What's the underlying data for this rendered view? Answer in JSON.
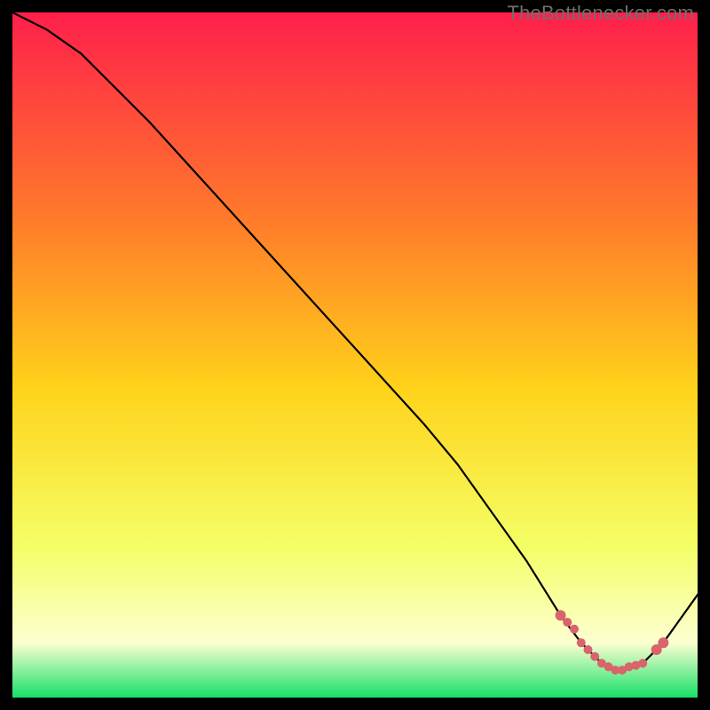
{
  "watermark": "TheBottlenecker.com",
  "colors": {
    "gradient_top": "#ff1f4b",
    "gradient_mid_upper": "#ff7a2a",
    "gradient_mid": "#ffd31a",
    "gradient_mid_lower": "#f4ff66",
    "gradient_pale": "#fcffd0",
    "gradient_bottom": "#17e06a",
    "curve": "#000000",
    "marker": "#d9646b"
  },
  "chart_data": {
    "type": "line",
    "title": "",
    "xlabel": "",
    "ylabel": "",
    "xlim": [
      0,
      100
    ],
    "ylim": [
      0,
      100
    ],
    "series": [
      {
        "name": "bottleneck-curve",
        "x": [
          0,
          2,
          5,
          10,
          20,
          30,
          40,
          50,
          60,
          65,
          70,
          75,
          80,
          83,
          86,
          88,
          90,
          92,
          95,
          100
        ],
        "y": [
          100,
          99,
          97.5,
          94,
          84,
          73,
          62,
          51,
          40,
          34,
          27,
          20,
          12,
          8,
          5,
          4,
          4.5,
          5,
          8,
          15
        ]
      }
    ],
    "markers": {
      "name": "optimal-range",
      "x": [
        80,
        81,
        82,
        83,
        84,
        85,
        86,
        87,
        88,
        89,
        90,
        91,
        92,
        94,
        95
      ],
      "y": [
        12,
        11,
        10,
        8,
        7,
        6,
        5,
        4.5,
        4,
        4,
        4.5,
        4.7,
        5,
        7,
        8
      ]
    }
  }
}
